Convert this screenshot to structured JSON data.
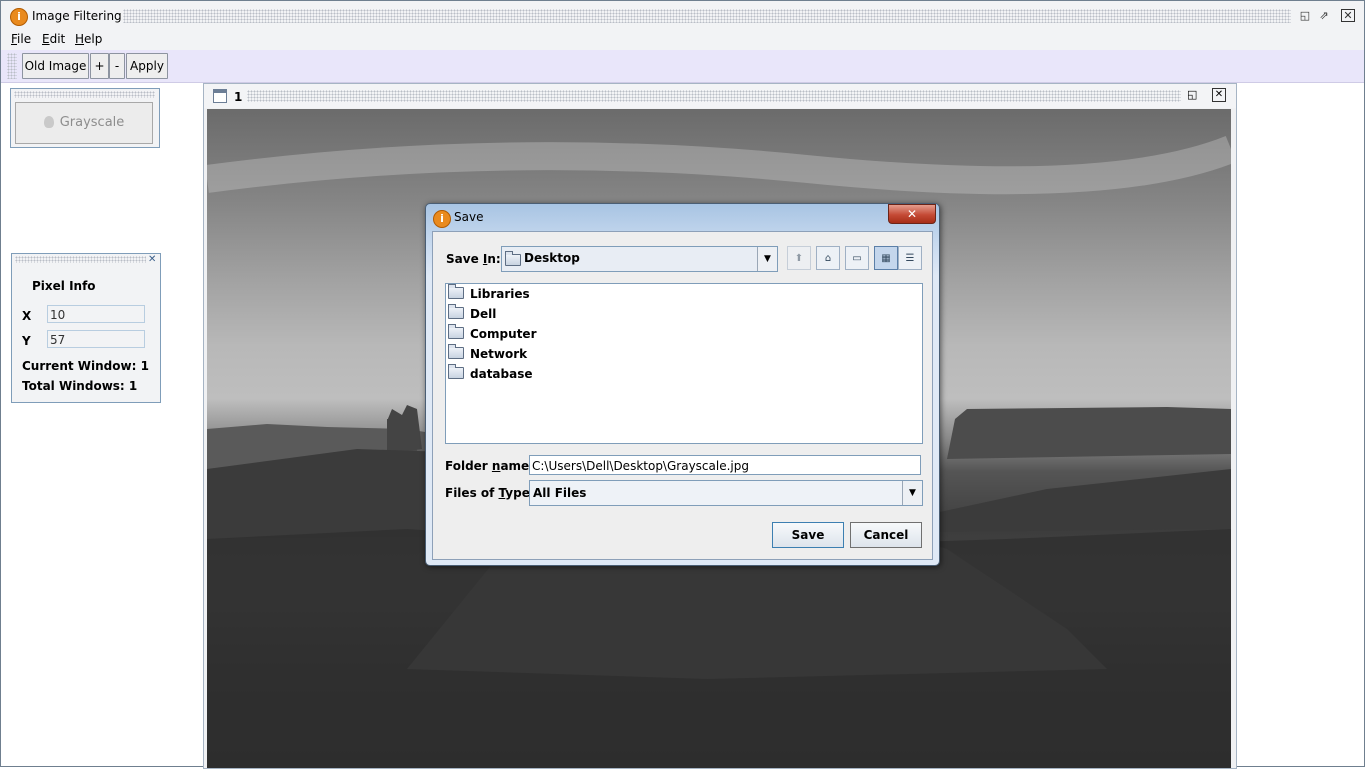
{
  "app": {
    "title": "Image Filtering",
    "icon": "app-logo-icon"
  },
  "window_controls": {
    "minimize": "◱",
    "maximize": "⇗",
    "close": "✕"
  },
  "menubar": {
    "file": {
      "mnemonic": "F",
      "rest": "ile"
    },
    "edit": {
      "mnemonic": "E",
      "rest": "dit"
    },
    "help": {
      "mnemonic": "H",
      "rest": "elp"
    }
  },
  "toolbar": {
    "old_image": "Old Image",
    "zoom_in": "+",
    "zoom_out": "-",
    "apply": "Apply"
  },
  "filters_panel": {
    "grayscale_label": "Grayscale"
  },
  "pixel_info": {
    "title": "Pixel Info",
    "x_label": "X",
    "x_value": "10",
    "y_label": "Y",
    "y_value": "57",
    "current_window_label": "Current Window:",
    "current_window_value": "1",
    "total_windows_label": "Total Windows:",
    "total_windows_value": "1"
  },
  "internal_frame": {
    "title": "1"
  },
  "save_dialog": {
    "title": "Save",
    "close_glyph": "✕",
    "save_in_label_a": "Save ",
    "save_in_mnemonic": "I",
    "save_in_label_b": "n:",
    "save_in_value": "Desktop",
    "combo_arrow": "▼",
    "icon_buttons": {
      "up": "⬆",
      "home": "⌂",
      "new_folder": "▭",
      "list": "▦",
      "details": "☰"
    },
    "items": [
      "Libraries",
      "Dell",
      "Computer",
      "Network",
      "database"
    ],
    "folder_name_label_a": "Folder ",
    "folder_name_mnemonic": "n",
    "folder_name_label_b": "ame:",
    "folder_name_value": "C:\\Users\\Dell\\Desktop\\Grayscale.jpg",
    "files_type_label_a": "Files of ",
    "files_type_mnemonic": "T",
    "files_type_label_b": "ype:",
    "files_type_value": "All Files",
    "save_button": "Save",
    "cancel_button": "Cancel"
  },
  "colors": {
    "toolbar_bg": "#e9e6fa",
    "panel_bg": "#f2f3f5",
    "dialog_close": "#c44a35"
  }
}
